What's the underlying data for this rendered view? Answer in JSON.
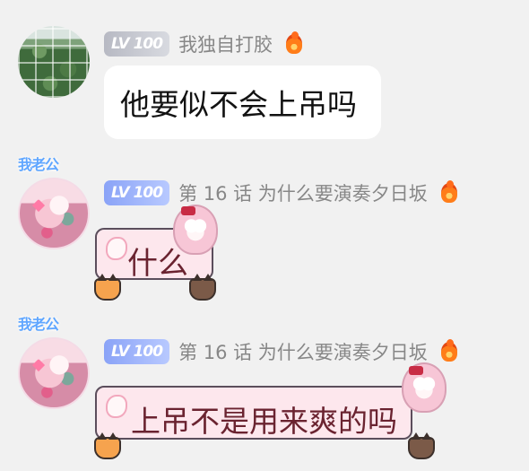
{
  "messages": [
    {
      "level": "LV 100",
      "username": "我独自打胶",
      "text": "他要似不会上吊吗"
    },
    {
      "avatar_label": "我老公",
      "level": "LV 100",
      "username": "第 16 话 为什么要演奏夕日坂",
      "text": "什么"
    },
    {
      "avatar_label": "我老公",
      "level": "LV 100",
      "username": "第 16 话 为什么要演奏夕日坂",
      "text": "上吊不是用来爽的吗"
    }
  ],
  "colors": {
    "background": "#f1f1f1",
    "username": "#878787",
    "message_text": "#121212",
    "card_fill": "#fde7ed",
    "card_text": "#6a2330",
    "level_badge_gray": "#b7b9c3",
    "level_badge_blue": "#8aa3f7"
  },
  "icons": [
    "fire-icon",
    "avatar",
    "cat-sticker",
    "anime-girl-sticker"
  ]
}
